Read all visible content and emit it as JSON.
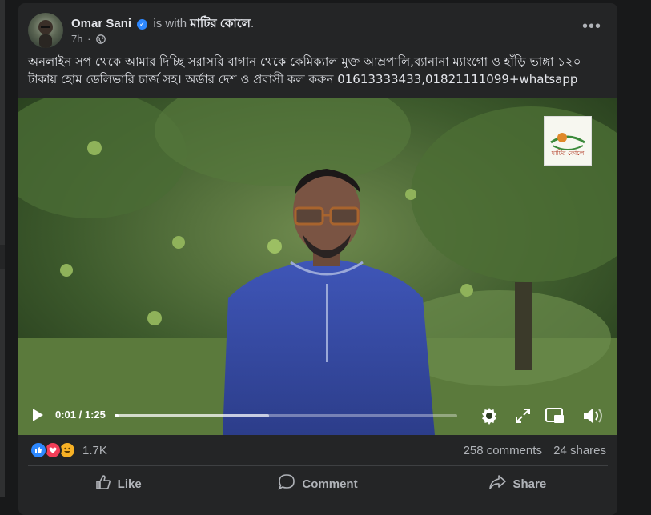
{
  "post": {
    "author": "Omar Sani",
    "with_text": "is with",
    "page_name": "মাটির কোলে",
    "page_suffix": ".",
    "time": "7h",
    "more_label": "•••",
    "text": "অনলাইন সপ থেকে আমার দিচ্ছি সরাসরি বাগান থেকে কেমিক্যাল মুক্ত আম্রপালি,ব্যানানা ম্যাংগো ও হাঁড়ি ভাঙ্গা ১২০ টাকায় হোম ডেলিভারি চার্জ সহ। অর্ডার দেশ ও প্রবাসী কল করুন 01613333433,01821111099+whatsapp"
  },
  "video": {
    "current_time": "0:01",
    "duration": "1:25",
    "time_display": "0:01 / 1:25",
    "played_fraction": 0.012,
    "buffered_fraction": 0.45,
    "logo_text": "মাটির কোলে"
  },
  "engagement": {
    "reaction_count": "1.7K",
    "comments": "258 comments",
    "shares": "24 shares",
    "reactions": [
      "like",
      "love",
      "haha"
    ]
  },
  "actions": {
    "like": "Like",
    "comment": "Comment",
    "share": "Share"
  },
  "colors": {
    "background": "#18191a",
    "card": "#242526",
    "text_primary": "#e4e6eb",
    "text_secondary": "#b0b3b8",
    "like_blue": "#2d88ff",
    "love_red": "#f33e58",
    "haha_yellow": "#f7b125"
  }
}
